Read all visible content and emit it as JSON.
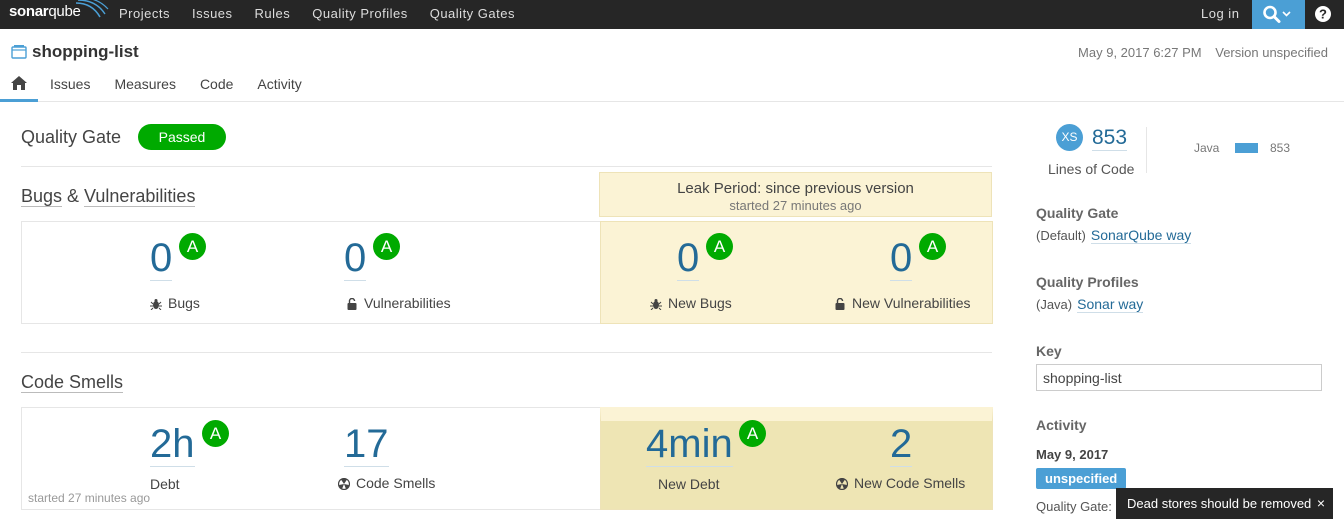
{
  "topbar": {
    "logo": {
      "part1": "sonar",
      "part2": "qube"
    },
    "nav": [
      "Projects",
      "Issues",
      "Rules",
      "Quality Profiles",
      "Quality Gates"
    ],
    "login": "Log in"
  },
  "project": {
    "name": "shopping-list",
    "date": "May 9, 2017 6:27 PM",
    "version": "Version unspecified",
    "tabs": [
      "Issues",
      "Measures",
      "Code",
      "Activity"
    ]
  },
  "quality_gate": {
    "title": "Quality Gate",
    "status": "Passed"
  },
  "bugs_section": {
    "title_part1": "Bugs",
    "amp": " & ",
    "title_part2": "Vulnerabilities",
    "leak_title": "Leak Period: since previous version",
    "leak_sub": "started 27 minutes ago",
    "metrics": [
      {
        "value": "0",
        "rating": "A",
        "label": "Bugs"
      },
      {
        "value": "0",
        "rating": "A",
        "label": "Vulnerabilities"
      },
      {
        "value": "0",
        "rating": "A",
        "label": "New Bugs"
      },
      {
        "value": "0",
        "rating": "A",
        "label": "New Vulnerabilities"
      }
    ]
  },
  "smells_section": {
    "title": "Code Smells",
    "metrics": [
      {
        "value": "2h",
        "rating": "A",
        "label": "Debt"
      },
      {
        "value": "17",
        "label": "Code Smells"
      },
      {
        "value": "4min",
        "rating": "A",
        "label": "New Debt"
      },
      {
        "value": "2",
        "label": "New Code Smells"
      }
    ],
    "started": "started 27 minutes ago"
  },
  "sidebar": {
    "size_badge": "XS",
    "loc_value": "853",
    "loc_label": "Lines of Code",
    "lang_name": "Java",
    "lang_count": "853",
    "qg_heading": "Quality Gate",
    "qg_default": "(Default)",
    "qg_link": "SonarQube way",
    "qp_heading": "Quality Profiles",
    "qp_lang": "(Java)",
    "qp_link": "Sonar way",
    "key_heading": "Key",
    "key_value": "shopping-list",
    "activity_heading": "Activity",
    "activity_date": "May 9, 2017",
    "activity_version": "unspecified",
    "activity_qg": "Quality Gate:"
  },
  "toast": {
    "message": "Dead stores should be removed",
    "close": "×"
  },
  "colors": {
    "accent": "#4b9fd5",
    "passed": "#00aa00",
    "leak_bg": "#fbf3d5",
    "value": "#236a97",
    "topbar": "#262626"
  }
}
